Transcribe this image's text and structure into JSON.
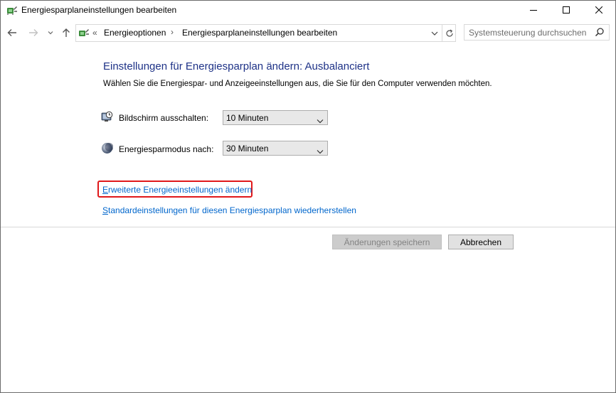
{
  "window": {
    "title": "Energiesparplaneinstellungen bearbeiten",
    "icon": "power-options-icon"
  },
  "address_bar": {
    "overflow": "«",
    "breadcrumbs": [
      "Energieoptionen",
      "Energiesparplaneinstellungen bearbeiten"
    ],
    "separator": "›"
  },
  "search": {
    "placeholder": "Systemsteuerung durchsuchen"
  },
  "content": {
    "title": "Einstellungen für Energiesparplan ändern: Ausbalanciert",
    "subtitle": "Wählen Sie die Energiespar- und Anzeigeeinstellungen aus, die Sie für den Computer verwenden möchten.",
    "settings": [
      {
        "label": "Bildschirm ausschalten:",
        "value": "10 Minuten",
        "icon": "monitor-clock-icon"
      },
      {
        "label": "Energiesparmodus nach:",
        "value": "30 Minuten",
        "icon": "moon-icon"
      }
    ],
    "links": {
      "advanced_first": "E",
      "advanced_rest": "rweiterte Energieeinstellungen ändern",
      "restore_first": "S",
      "restore_rest": "tandardeinstellungen für diesen Energiesparplan wiederherstellen"
    }
  },
  "buttons": {
    "save": "Änderungen speichern",
    "cancel": "Abbrechen"
  },
  "colors": {
    "title_blue": "#1e3287",
    "link_blue": "#0066cc",
    "highlight_red": "#e0181a"
  }
}
